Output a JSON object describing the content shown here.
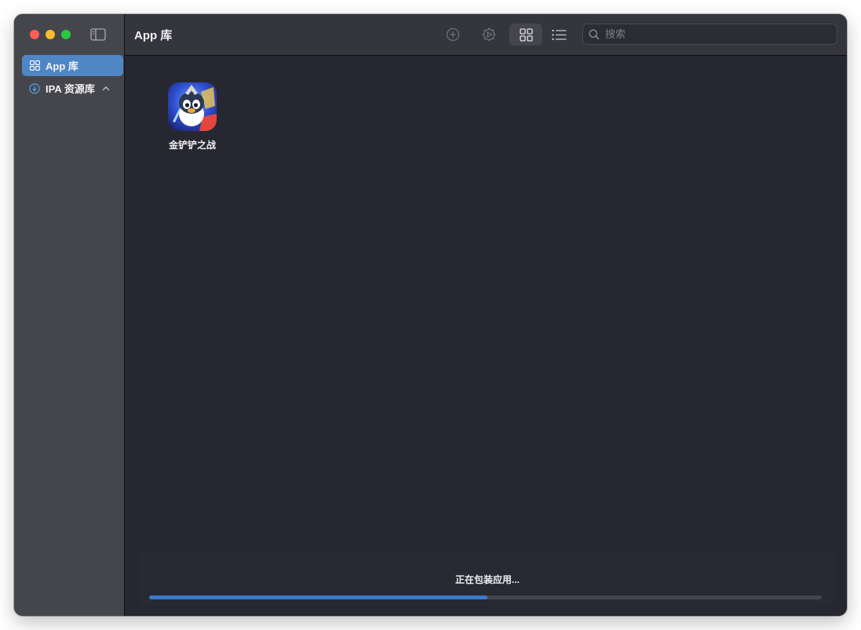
{
  "window": {
    "title": "App 库"
  },
  "sidebar": {
    "items": [
      {
        "label": "App 库",
        "icon": "grid-icon",
        "active": true
      },
      {
        "label": "IPA 资源库",
        "icon": "download-circle-icon",
        "expanded": true
      }
    ]
  },
  "toolbar": {
    "title": "App 库",
    "buttons": [
      "add-icon",
      "settings-icon",
      "grid-view-icon",
      "list-view-icon"
    ],
    "search": {
      "placeholder": "搜索",
      "value": ""
    }
  },
  "apps": [
    {
      "name": "金铲铲之战"
    }
  ],
  "status": {
    "text": "正在包装应用...",
    "progress": 0.503
  },
  "colors": {
    "accent": "#4f86c5",
    "progress": "#3b79c9",
    "sidebar_bg": "#45464c",
    "content_bg": "#262731"
  }
}
